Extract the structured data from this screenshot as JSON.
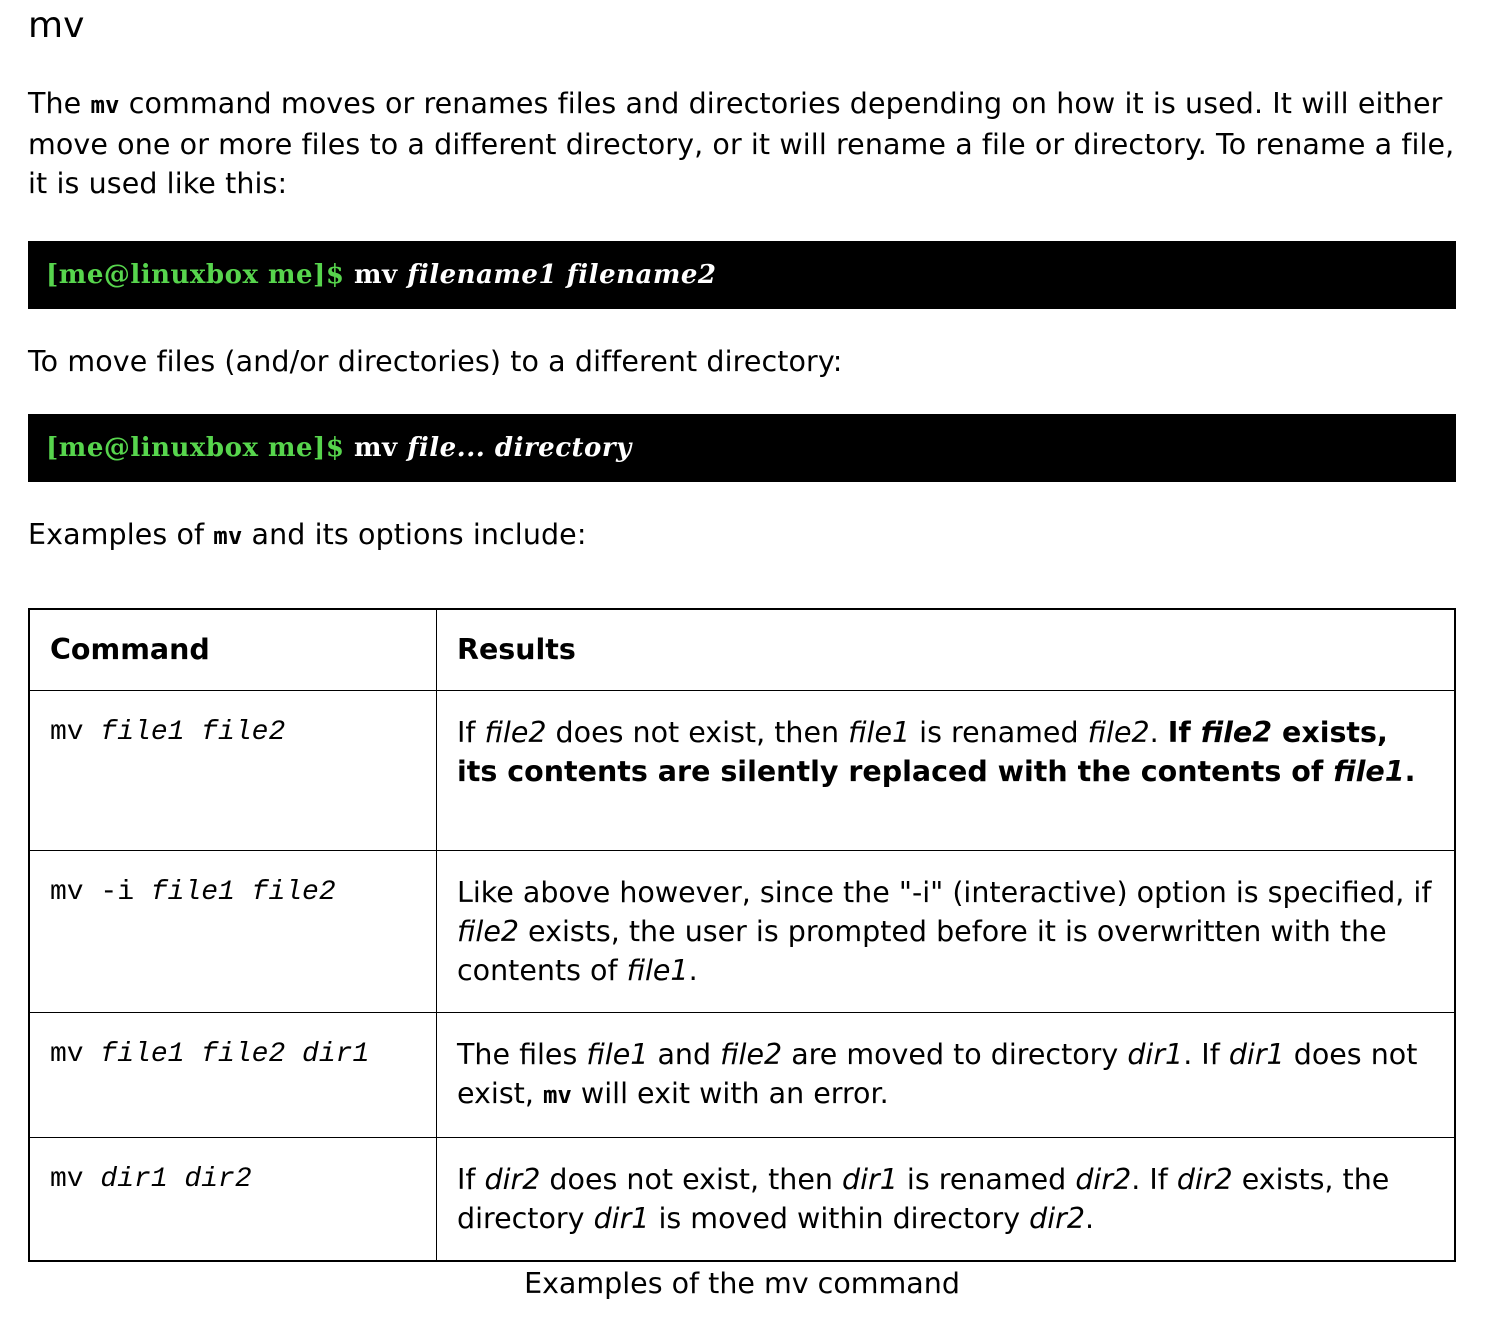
{
  "heading": "mv",
  "intro": {
    "before_code": "The ",
    "code": "mv",
    "after_code": " command moves or renames files and directories depending on how it is used. It will either move one or more files to a different directory, or it will rename a file or directory. To rename a file, it is used like this:"
  },
  "terminal1": {
    "prompt": "[me@linuxbox me]$",
    "command": "mv",
    "arg1": "filename1",
    "arg2": "filename2"
  },
  "move_text": "To move files (and/or directories) to a different directory:",
  "terminal2": {
    "prompt": "[me@linuxbox me]$",
    "command": "mv",
    "arg1": "file...",
    "arg2": "directory"
  },
  "examples_text": {
    "before_code": "Examples of ",
    "code": "mv",
    "after_code": " and its options include:"
  },
  "table": {
    "headers": [
      "Command",
      "Results"
    ],
    "rows": [
      {
        "cmd": "mv",
        "args": "file1 file2",
        "result": {
          "t1": "If ",
          "e1": "file2",
          "t2": " does not exist, then ",
          "e2": "file1",
          "t3": " is renamed ",
          "e3": "file2",
          "t4": ". ",
          "b1": "If ",
          "be1": "file2",
          "b2": " exists, its contents are silently replaced with the contents of ",
          "be2": "file1",
          "b3": "."
        }
      },
      {
        "cmd": "mv -i",
        "args": "file1 file2",
        "result": {
          "t1": "Like above however, since the \"-i\" (interactive) option is specified, if ",
          "e1": "file2",
          "t2": " exists, the user is prompted before it is overwritten with the contents of ",
          "e2": "file1",
          "t3": "."
        }
      },
      {
        "cmd": "mv",
        "args": "file1 file2 dir1",
        "result": {
          "t1": "The files ",
          "e1": "file1",
          "t2": " and ",
          "e2": "file2",
          "t3": " are moved to directory ",
          "e3": "dir1",
          "t4": ". If ",
          "e4": "dir1",
          "t5": " does not exist, ",
          "c1": "mv",
          "t6": " will exit with an error."
        }
      },
      {
        "cmd": "mv",
        "args": "dir1 dir2",
        "result": {
          "t1": "If ",
          "e1": "dir2",
          "t2": " does not exist, then ",
          "e2": "dir1",
          "t3": " is renamed ",
          "e3": "dir2",
          "t4": ". If ",
          "e4": "dir2",
          "t5": " exists, the directory ",
          "e5": "dir1",
          "t6": " is moved within directory ",
          "e6": "dir2",
          "t7": "."
        }
      }
    ]
  },
  "caption": "Examples of the mv command"
}
